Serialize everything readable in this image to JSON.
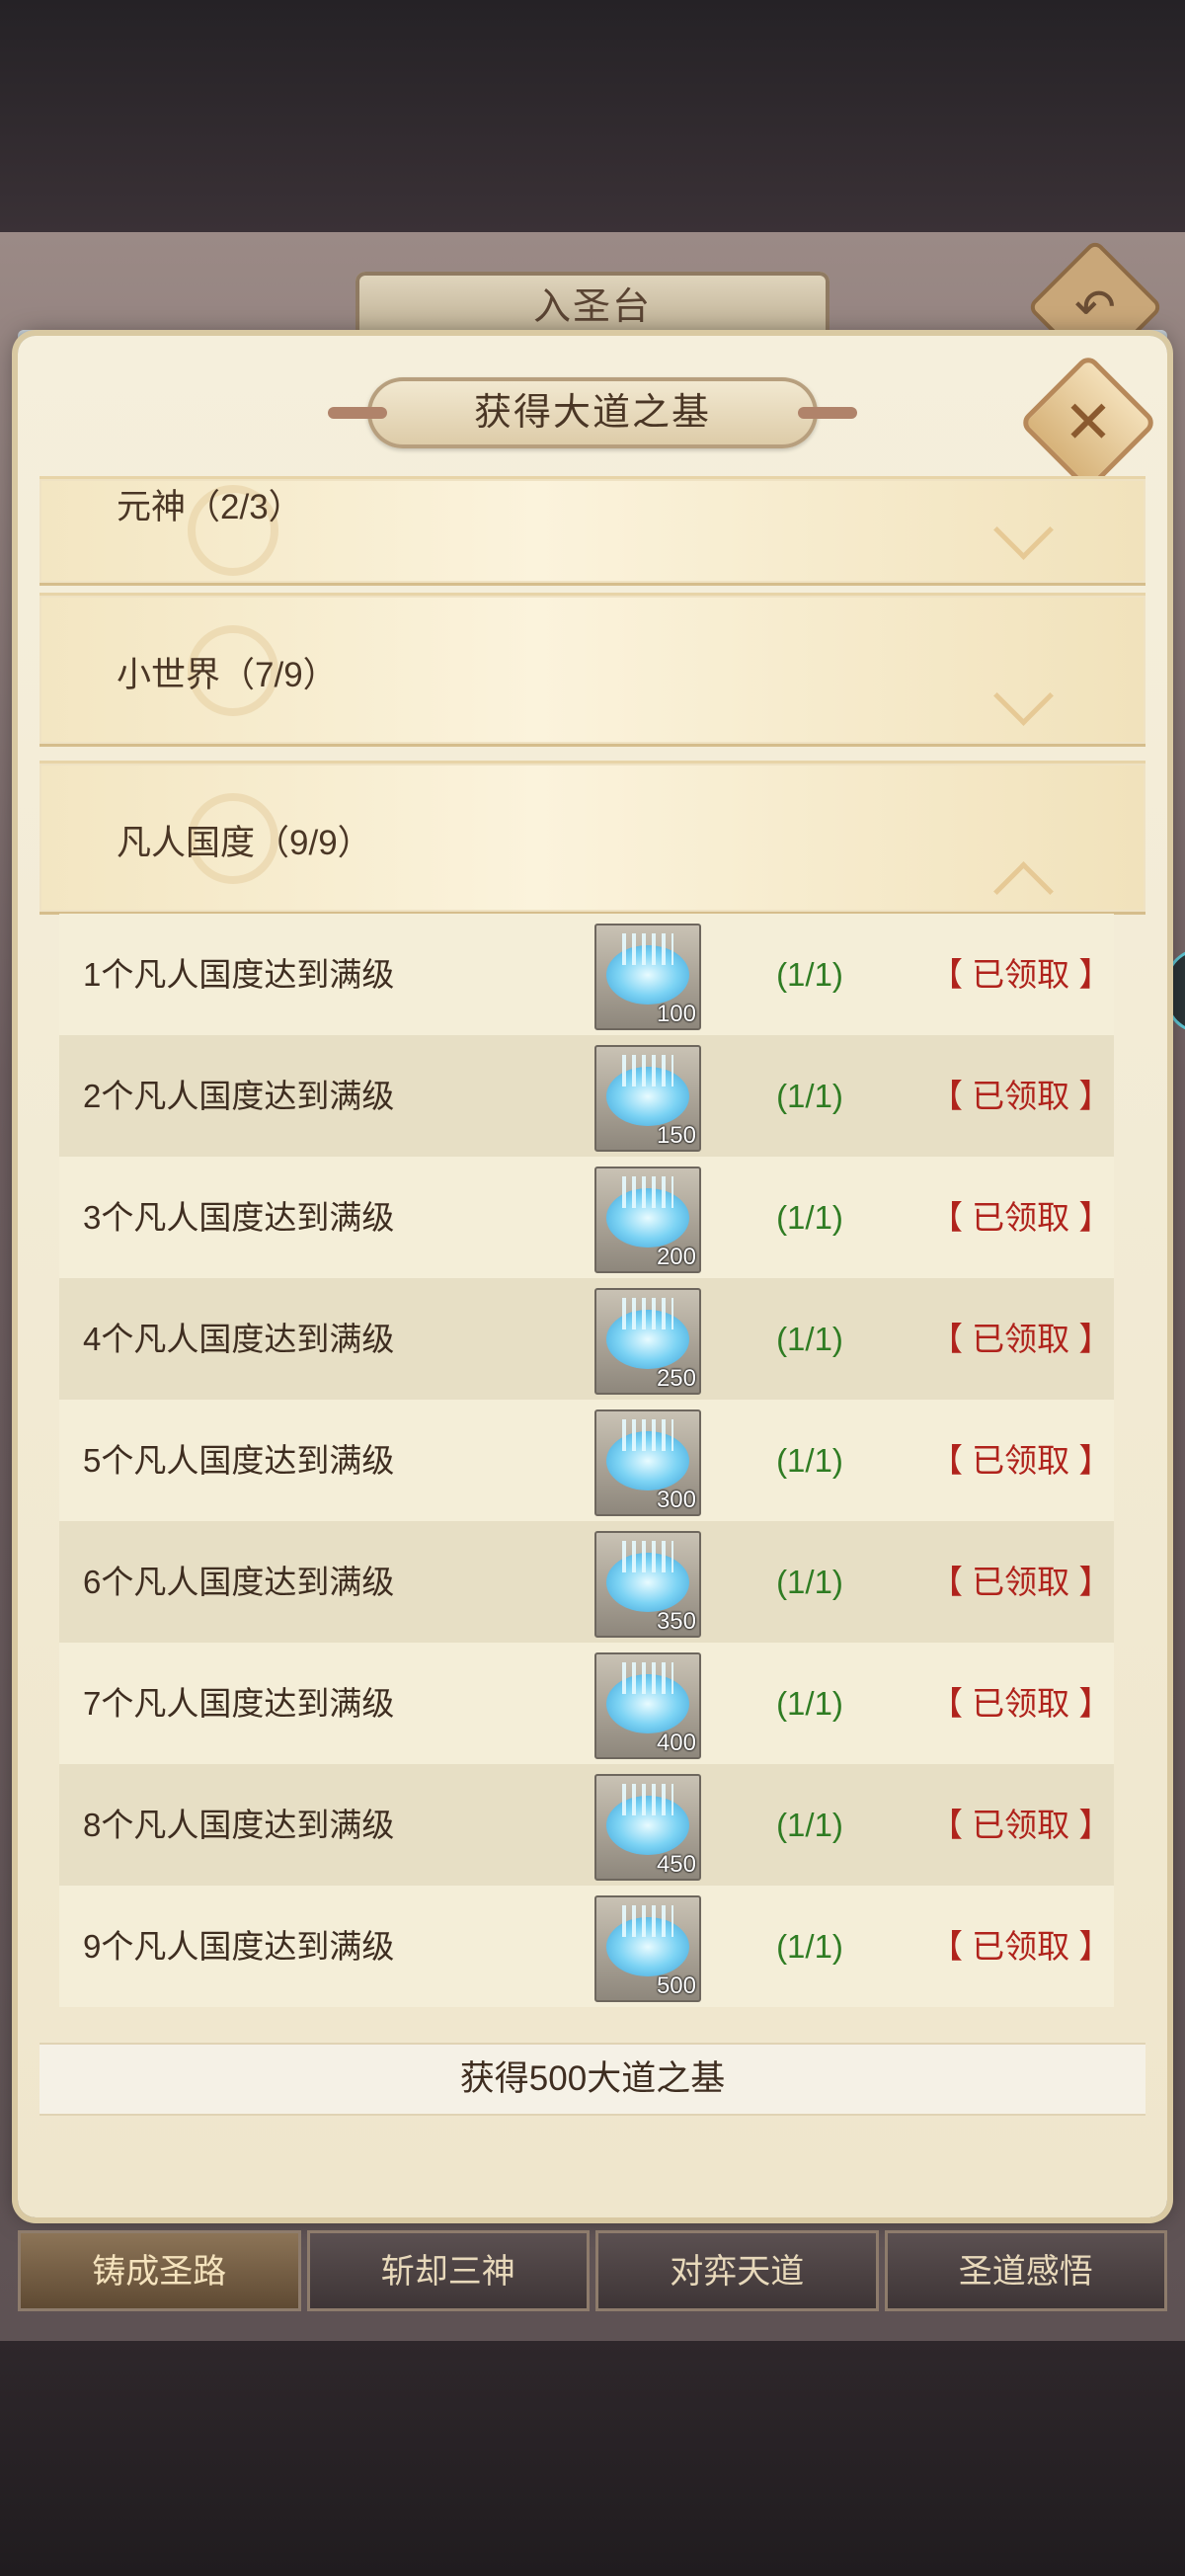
{
  "background": {
    "screen_title": "入圣台",
    "back_icon": "back-arrow-icon"
  },
  "modal": {
    "title": "获得大道之基",
    "close_icon": "close-x-icon",
    "categories": [
      {
        "label": "元神（2/3）",
        "expanded": false
      },
      {
        "label": "小世界（7/9）",
        "expanded": false
      },
      {
        "label": "凡人国度（9/9）",
        "expanded": true
      }
    ],
    "rows": [
      {
        "text": "1个凡人国度达到满级",
        "item_icon": "dao-foundation-crystal-icon",
        "amount": "100",
        "progress": "(1/1)",
        "status": "【 已领取 】"
      },
      {
        "text": "2个凡人国度达到满级",
        "item_icon": "dao-foundation-crystal-icon",
        "amount": "150",
        "progress": "(1/1)",
        "status": "【 已领取 】"
      },
      {
        "text": "3个凡人国度达到满级",
        "item_icon": "dao-foundation-crystal-icon",
        "amount": "200",
        "progress": "(1/1)",
        "status": "【 已领取 】"
      },
      {
        "text": "4个凡人国度达到满级",
        "item_icon": "dao-foundation-crystal-icon",
        "amount": "250",
        "progress": "(1/1)",
        "status": "【 已领取 】"
      },
      {
        "text": "5个凡人国度达到满级",
        "item_icon": "dao-foundation-crystal-icon",
        "amount": "300",
        "progress": "(1/1)",
        "status": "【 已领取 】"
      },
      {
        "text": "6个凡人国度达到满级",
        "item_icon": "dao-foundation-crystal-icon",
        "amount": "350",
        "progress": "(1/1)",
        "status": "【 已领取 】"
      },
      {
        "text": "7个凡人国度达到满级",
        "item_icon": "dao-foundation-crystal-icon",
        "amount": "400",
        "progress": "(1/1)",
        "status": "【 已领取 】"
      },
      {
        "text": "8个凡人国度达到满级",
        "item_icon": "dao-foundation-crystal-icon",
        "amount": "450",
        "progress": "(1/1)",
        "status": "【 已领取 】"
      },
      {
        "text": "9个凡人国度达到满级",
        "item_icon": "dao-foundation-crystal-icon",
        "amount": "500",
        "progress": "(1/1)",
        "status": "【 已领取 】"
      }
    ],
    "summary": "获得500大道之基"
  },
  "tabs": [
    {
      "label": "铸成圣路",
      "active": true
    },
    {
      "label": "斩却三神",
      "active": false
    },
    {
      "label": "对弈天道",
      "active": false
    },
    {
      "label": "圣道感悟",
      "active": false
    }
  ],
  "colors": {
    "progress_green": "#2f7c23",
    "claimed_red": "#b0231c",
    "text_brown": "#3e2d20"
  }
}
